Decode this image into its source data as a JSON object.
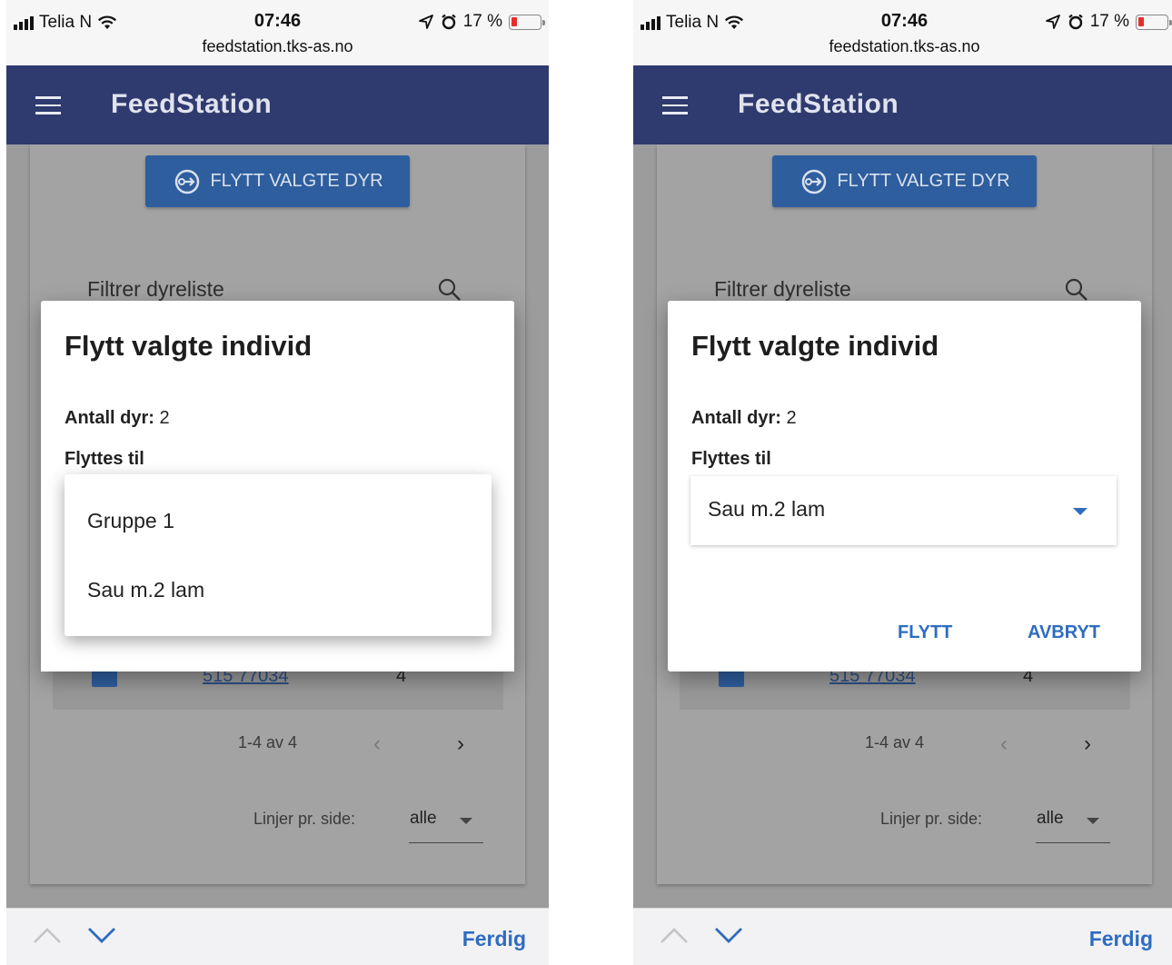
{
  "statusbar": {
    "carrier": "Telia N",
    "time": "07:46",
    "url": "feedstation.tks-as.no",
    "battery": "17 %"
  },
  "appbar": {
    "title": "FeedStation"
  },
  "content": {
    "move_button_label": "FLYTT VALGTE DYR",
    "filter_placeholder": "Filtrer dyreliste",
    "row_link": "515 77034",
    "row_value": "4",
    "pagination_text": "1-4 av 4",
    "rows_per_page_label": "Linjer pr. side:",
    "rows_per_page_value": "alle"
  },
  "dialog": {
    "title": "Flytt valgte individ",
    "count_label": "Antall dyr:",
    "count_value": " 2",
    "target_label": "Flyttes til",
    "options": [
      "Gruppe 1",
      "Sau m.2 lam"
    ],
    "selected": "Sau m.2 lam",
    "flytt_label": "FLYTT",
    "avbryt_label": "AVBRYT"
  },
  "toolbar": {
    "done_label": "Ferdig"
  },
  "colors": {
    "appbar": "#2f3a6e",
    "accent": "#2e6cc0",
    "button": "#2e5e9e"
  }
}
